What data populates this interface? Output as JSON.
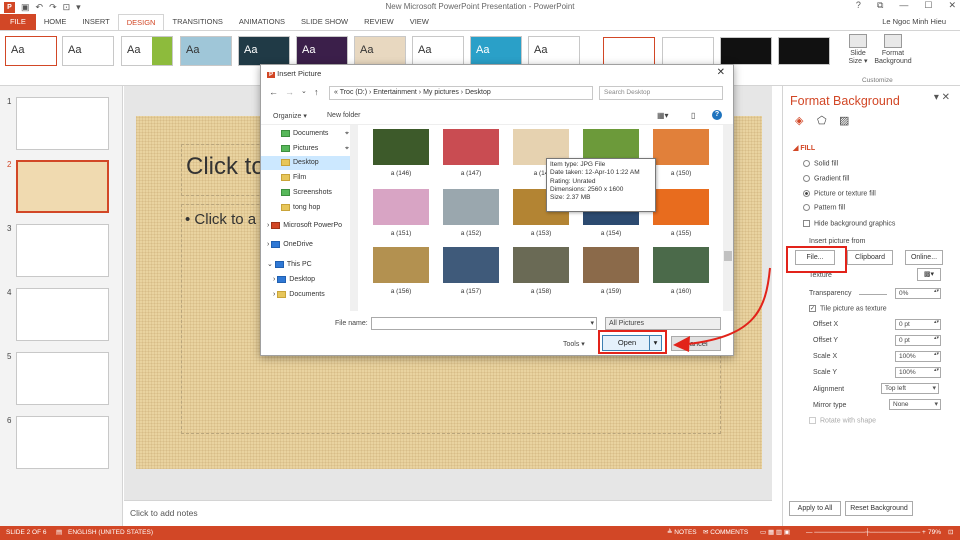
{
  "window": {
    "title": "New Microsoft PowerPoint Presentation - PowerPoint",
    "user": "Le Ngoc Minh Hieu"
  },
  "tabs": [
    {
      "label": "FILE"
    },
    {
      "label": "HOME"
    },
    {
      "label": "INSERT"
    },
    {
      "label": "DESIGN"
    },
    {
      "label": "TRANSITIONS"
    },
    {
      "label": "ANIMATIONS"
    },
    {
      "label": "SLIDE SHOW"
    },
    {
      "label": "REVIEW"
    },
    {
      "label": "VIEW"
    }
  ],
  "ribbon": {
    "theme_sample": "Aa",
    "slide_size": "Slide Size ▾",
    "format_background": "Format Background",
    "group_customize": "Customize"
  },
  "thumbnails": [
    {
      "num": "1"
    },
    {
      "num": "2"
    },
    {
      "num": "3"
    },
    {
      "num": "4"
    },
    {
      "num": "5"
    },
    {
      "num": "6"
    }
  ],
  "slide": {
    "title": "Click to",
    "body": "• Click to a"
  },
  "notes": "Click to add notes",
  "format_pane": {
    "title": "Format Background",
    "fill_header": "FILL",
    "options": [
      "Solid fill",
      "Gradient fill",
      "Picture or texture fill",
      "Pattern fill"
    ],
    "hide_bg": "Hide background graphics",
    "insert_from": "Insert picture from",
    "file_btn": "File...",
    "clipboard_btn": "Clipboard",
    "online_btn": "Online...",
    "texture": "Texture",
    "transparency": "Transparency",
    "transparency_val": "0%",
    "tile": "Tile picture as texture",
    "offset_x": "Offset X",
    "offset_x_val": "0 pt",
    "offset_y": "Offset Y",
    "offset_y_val": "0 pt",
    "scale_x": "Scale X",
    "scale_x_val": "100%",
    "scale_y": "Scale Y",
    "scale_y_val": "100%",
    "alignment": "Alignment",
    "alignment_val": "Top left",
    "mirror": "Mirror type",
    "mirror_val": "None",
    "rotate": "Rotate with shape",
    "apply_all": "Apply to All",
    "reset": "Reset Background"
  },
  "status": {
    "slide": "SLIDE 2 OF 6",
    "lang": "ENGLISH (UNITED STATES)",
    "notes": "≜ NOTES",
    "comments": "✉ COMMENTS",
    "zoom": "79%"
  },
  "dialog": {
    "title": "Insert Picture",
    "path": "«  Troc (D:)  ›  Entertainment  ›  My pictures  ›  Desktop",
    "search_placeholder": "Search Desktop",
    "organize": "Organize ▾",
    "new_folder": "New folder",
    "tree": [
      {
        "label": "Documents"
      },
      {
        "label": "Pictures"
      },
      {
        "label": "Desktop"
      },
      {
        "label": "Film"
      },
      {
        "label": "Screenshots"
      },
      {
        "label": "tong hop"
      },
      {
        "label": "Microsoft PowerPo"
      },
      {
        "label": "OneDrive"
      },
      {
        "label": "This PC"
      },
      {
        "label": "Desktop"
      },
      {
        "label": "Documents"
      }
    ],
    "photos": [
      {
        "label": "a (146)",
        "color": "#3d5a2a"
      },
      {
        "label": "a (147)",
        "color": "#c94c52"
      },
      {
        "label": "a (14",
        "color": "#e6d2b0"
      },
      {
        "label": "a (149)",
        "color": "#6c9a3a"
      },
      {
        "label": "a (150)",
        "color": "#e1803a"
      },
      {
        "label": "a (151)",
        "color": "#d8a4c4"
      },
      {
        "label": "a (152)",
        "color": "#9aa7ae"
      },
      {
        "label": "a (153)",
        "color": "#b38433"
      },
      {
        "label": "a (154)",
        "color": "#2c4a70"
      },
      {
        "label": "a (155)",
        "color": "#e86c1e"
      },
      {
        "label": "a (156)",
        "color": "#b39150"
      },
      {
        "label": "a (157)",
        "color": "#3f5a7a"
      },
      {
        "label": "a (158)",
        "color": "#6a6a55"
      },
      {
        "label": "a (159)",
        "color": "#8b6a4a"
      },
      {
        "label": "a (160)",
        "color": "#4b6a4a"
      }
    ],
    "tooltip": [
      "Item type: JPG File",
      "Date taken: 12-Apr-10 1:22 AM",
      "Rating: Unrated",
      "Dimensions: 2560 x 1600",
      "Size: 2.37 MB"
    ],
    "filename_label": "File name:",
    "filter": "All Pictures",
    "tools": "Tools ▾",
    "open": "Open",
    "cancel": "Cancel"
  }
}
